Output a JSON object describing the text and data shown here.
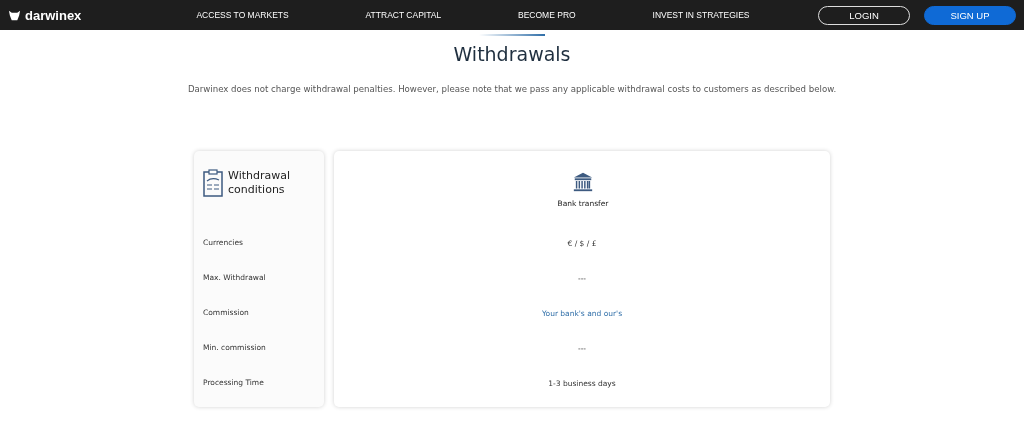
{
  "nav": {
    "logo": "darwinex",
    "links": [
      "ACCESS TO MARKETS",
      "ATTRACT CAPITAL",
      "BECOME PRO",
      "INVEST IN STRATEGIES"
    ],
    "buttons": [
      {
        "label": "LOGIN",
        "kind": "outline"
      },
      {
        "label": "SIGN UP",
        "kind": "filled"
      }
    ]
  },
  "heading": "Withdrawals",
  "intro": "Darwinex does not charge withdrawal penalties. However, please note that we pass any applicable withdrawal costs to customers as described below.",
  "conditions": {
    "title": "Withdrawal conditions",
    "method": "Bank transfer",
    "rows": [
      {
        "label": "Currencies",
        "value": "€ / $ / £",
        "kind": "text"
      },
      {
        "label": "Max. Withdrawal",
        "value": "---",
        "kind": "text"
      },
      {
        "label": "Commission",
        "value": "Your bank's and our's",
        "kind": "link"
      },
      {
        "label": "Min. commission",
        "value": "---",
        "kind": "text"
      },
      {
        "label": "Processing Time",
        "value": "1-3 business days",
        "kind": "text"
      }
    ]
  }
}
